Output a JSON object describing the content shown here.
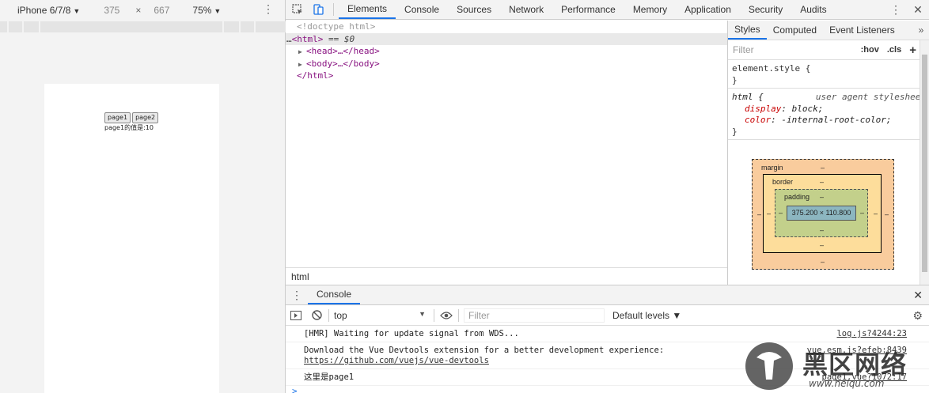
{
  "device_toolbar": {
    "device": "iPhone 6/7/8",
    "width": "375",
    "times": "×",
    "height": "667",
    "zoom": "75%"
  },
  "preview": {
    "buttons": [
      "page1",
      "page2"
    ],
    "value_text": "page1的值是:10"
  },
  "devtools": {
    "tabs": [
      "Elements",
      "Console",
      "Sources",
      "Network",
      "Performance",
      "Memory",
      "Application",
      "Security",
      "Audits"
    ],
    "active_tab": "Elements"
  },
  "elements": {
    "lines": [
      {
        "text": "<!doctype html>"
      },
      {
        "text": "<html>",
        "suffix": " == $0",
        "prefix": "…"
      },
      {
        "text": "<head>…</head>"
      },
      {
        "text": "<body>…</body>"
      },
      {
        "text": "</html>"
      }
    ],
    "breadcrumb": "html"
  },
  "styles": {
    "tabs": [
      "Styles",
      "Computed",
      "Event Listeners"
    ],
    "more": "»",
    "filter_placeholder": "Filter",
    "hov": ":hov",
    "cls": ".cls",
    "plus": "+",
    "element_style": "element.style {",
    "close_brace": "}",
    "rule_selector": "html {",
    "rule_source": "user agent stylesheet",
    "decl1_name": "display",
    "decl1_value": "block;",
    "decl2_name": "color",
    "decl2_value": "-internal-root-color;"
  },
  "box_model": {
    "margin_label": "margin",
    "border_label": "border",
    "padding_label": "padding",
    "dash": "–",
    "content": "375.200 × 110.800"
  },
  "drawer": {
    "tab": "Console",
    "context": "top",
    "filter_placeholder": "Filter",
    "levels": "Default levels ▼"
  },
  "console": {
    "messages": [
      {
        "text": "[HMR] Waiting for update signal from WDS...",
        "source": "log.js?4244:23"
      },
      {
        "text": "Download the Vue Devtools extension for a better development experience:",
        "link": "https://github.com/vuejs/vue-devtools",
        "source": "vue.esm.js?efeb:8439"
      },
      {
        "text": "这里是page1",
        "source": "page1.vue?1072:17"
      }
    ],
    "prompt": ">"
  },
  "watermark": {
    "brand": "黑区网络",
    "url": "www.heiqu.com"
  },
  "colors": {
    "accent": "#1a73e8",
    "margin": "#f9cc9d",
    "border": "#fddd9b",
    "padding": "#c3d08b",
    "content": "#8cb6c0"
  }
}
